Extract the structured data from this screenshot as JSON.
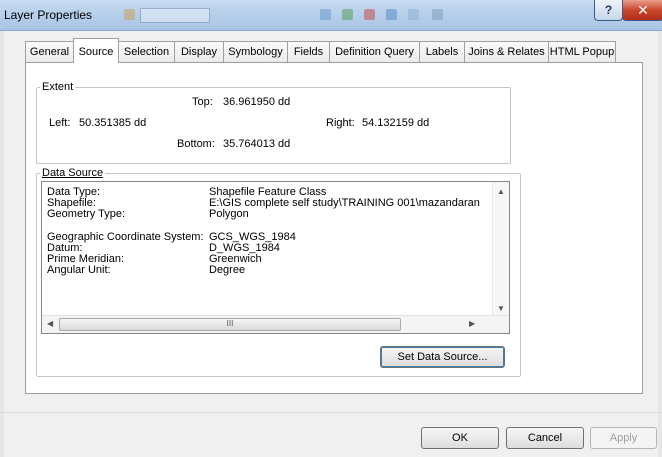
{
  "window": {
    "title": "Layer Properties",
    "help_glyph": "?",
    "close_glyph": "✕"
  },
  "tabs": [
    {
      "label": "General"
    },
    {
      "label": "Source"
    },
    {
      "label": "Selection"
    },
    {
      "label": "Display"
    },
    {
      "label": "Symbology"
    },
    {
      "label": "Fields"
    },
    {
      "label": "Definition Query"
    },
    {
      "label": "Labels"
    },
    {
      "label": "Joins & Relates"
    },
    {
      "label": "HTML Popup"
    }
  ],
  "extent": {
    "legend": "Extent",
    "top_label": "Top:",
    "top_value": "36.961950 dd",
    "left_label": "Left:",
    "left_value": "50.351385 dd",
    "right_label": "Right:",
    "right_value": "54.132159 dd",
    "bottom_label": "Bottom:",
    "bottom_value": "35.764013 dd"
  },
  "data_source": {
    "legend": "Data Source",
    "rows": [
      {
        "label": "Data Type:",
        "value": "Shapefile Feature Class"
      },
      {
        "label": "Shapefile:",
        "value": "E:\\GIS complete self  study\\TRAINING 001\\mazandaran"
      },
      {
        "label": "Geometry Type:",
        "value": "Polygon"
      },
      {
        "label": "Geographic Coordinate System:",
        "value": "GCS_WGS_1984"
      },
      {
        "label": "Datum:",
        "value": "D_WGS_1984"
      },
      {
        "label": "Prime Meridian:",
        "value": "Greenwich"
      },
      {
        "label": "Angular Unit:",
        "value": "Degree"
      }
    ],
    "scroll_thumb_glyph": "III",
    "set_button": "Set Data Source..."
  },
  "footer": {
    "ok": "OK",
    "cancel": "Cancel",
    "apply": "Apply"
  }
}
